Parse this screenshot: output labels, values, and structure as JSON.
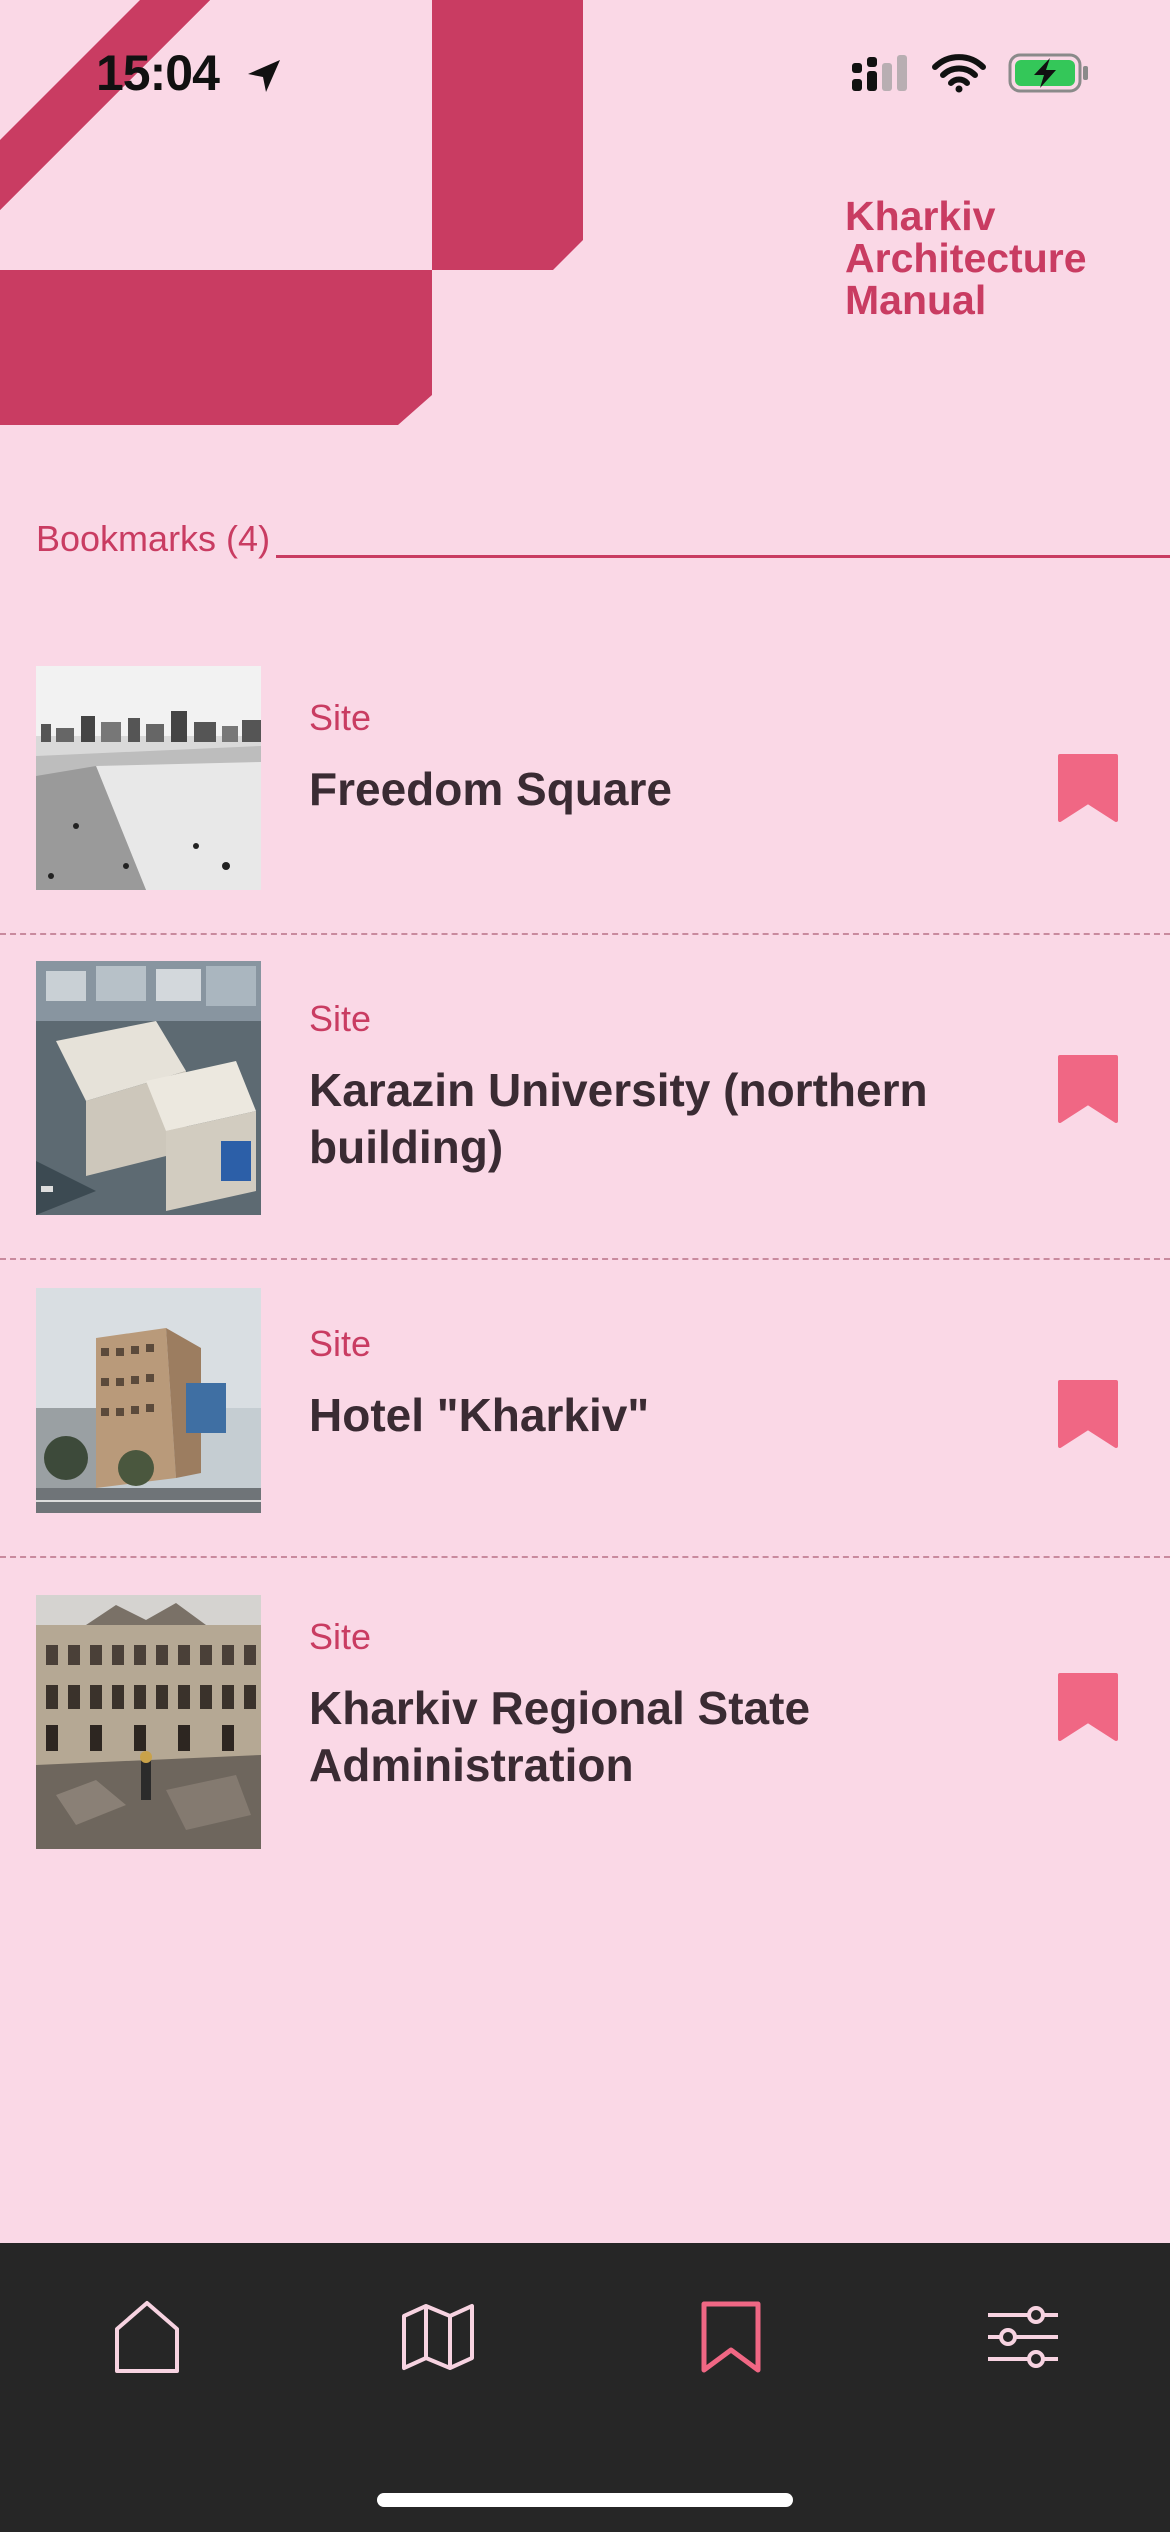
{
  "status_bar": {
    "time": "15:04"
  },
  "app": {
    "title": "Kharkiv Architecture Manual"
  },
  "colors": {
    "background": "#fad8e6",
    "accent": "#c93c62",
    "bookmark": "#f06784",
    "text": "#3a2b33",
    "tabbar": "#262626"
  },
  "bookmarks": {
    "header": "Bookmarks (4)",
    "items": [
      {
        "type": "Site",
        "name": "Freedom Square",
        "thumbnail": "freedom-square-photo"
      },
      {
        "type": "Site",
        "name": "Karazin University (northern building)",
        "thumbnail": "karazin-university-photo"
      },
      {
        "type": "Site",
        "name": "Hotel \"Kharkiv\"",
        "thumbnail": "hotel-kharkiv-photo"
      },
      {
        "type": "Site",
        "name": "Kharkiv Regional State Administration",
        "thumbnail": "regional-administration-photo"
      }
    ]
  },
  "tabbar": {
    "tabs": [
      {
        "icon": "home-icon",
        "active": false
      },
      {
        "icon": "map-icon",
        "active": false
      },
      {
        "icon": "bookmark-icon",
        "active": true
      },
      {
        "icon": "sliders-icon",
        "active": false
      }
    ]
  }
}
